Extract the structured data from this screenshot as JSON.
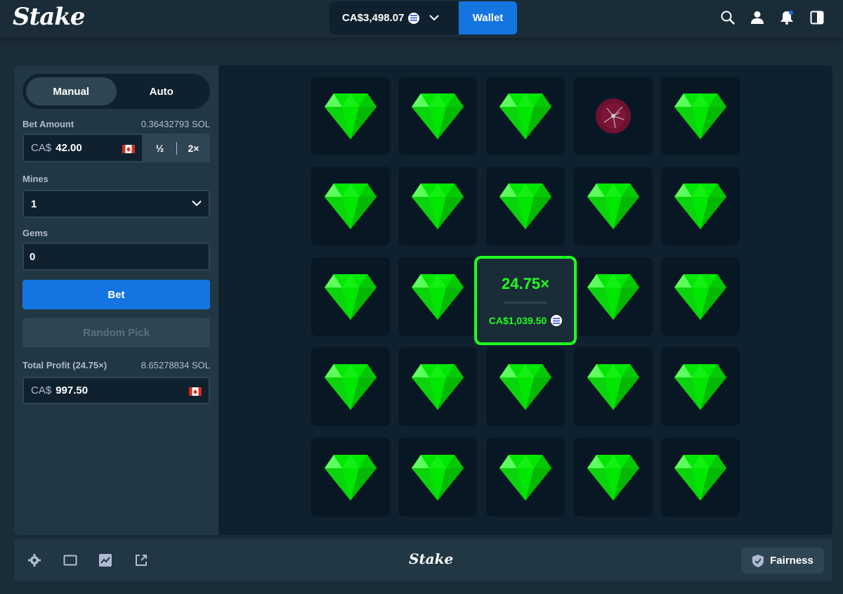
{
  "header": {
    "logo": "Stake",
    "balance": "CA$3,498.07",
    "wallet_label": "Wallet",
    "icons": [
      "search-icon",
      "user-icon",
      "bell-icon",
      "sidebar-toggle-icon"
    ]
  },
  "sidebar": {
    "modes": [
      "Manual",
      "Auto"
    ],
    "active_mode": "Manual",
    "bet_amount": {
      "label": "Bet Amount",
      "crypto": "0.36432793 SOL",
      "currency": "CA$",
      "value": "42.00",
      "half_label": "½",
      "double_label": "2×"
    },
    "mines": {
      "label": "Mines",
      "value": "1"
    },
    "gems": {
      "label": "Gems",
      "value": "0"
    },
    "bet_label": "Bet",
    "random_pick_label": "Random Pick",
    "total_profit": {
      "label": "Total Profit (24.75×)",
      "crypto": "8.65278834 SOL",
      "currency": "CA$",
      "value": "997.50"
    }
  },
  "board": {
    "rows": 5,
    "cols": 5,
    "mine_position": [
      0,
      3
    ],
    "win_position": [
      2,
      2
    ],
    "win_multiplier": "24.75×",
    "win_amount": "CA$1,039.50",
    "gem_color": "#1fff20"
  },
  "footer": {
    "logo": "Stake",
    "fairness_label": "Fairness",
    "icons": [
      "settings-icon",
      "theatre-mode-icon",
      "stats-icon",
      "popout-icon"
    ]
  },
  "colors": {
    "background": "#1a2c38",
    "panel": "#213743",
    "board": "#0f212e",
    "accent_blue": "#1475e1",
    "win_green": "#1fff20"
  }
}
